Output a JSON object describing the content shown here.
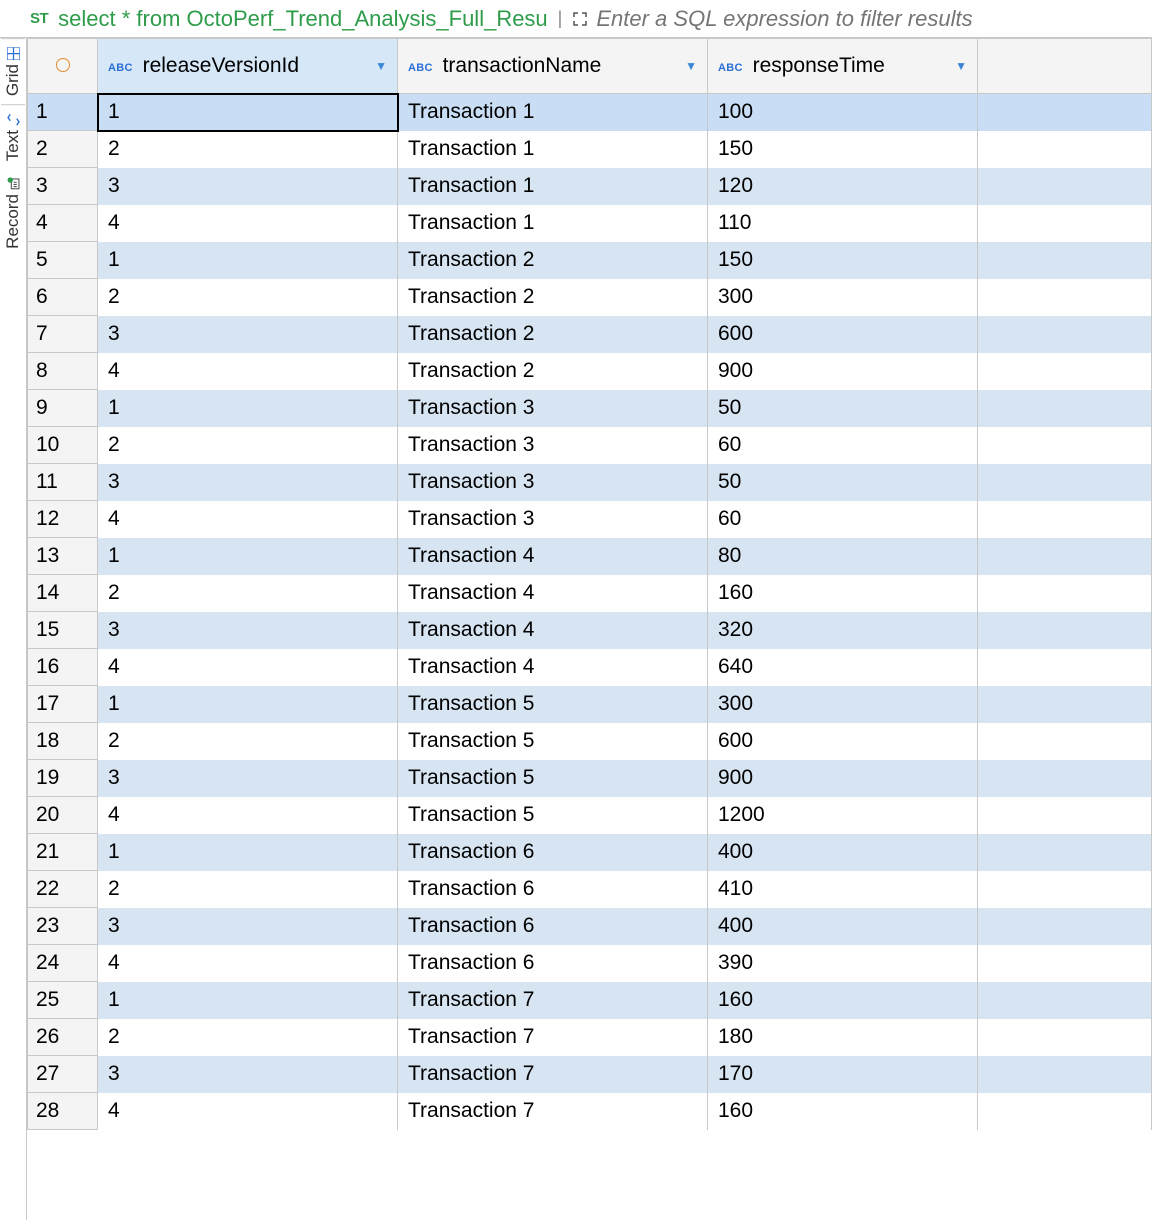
{
  "toolbar": {
    "sql_badge": "ST",
    "query": "select * from OctoPerf_Trend_Analysis_Full_Resu",
    "filter_placeholder": "Enter a SQL expression to filter results"
  },
  "sidebar": {
    "tabs": [
      {
        "label": "Grid",
        "icon": "grid-icon"
      },
      {
        "label": "Text",
        "icon": "text-arrows-icon"
      },
      {
        "label": "Record",
        "icon": "record-icon"
      }
    ]
  },
  "grid": {
    "columns": [
      {
        "type_badge": "ABC",
        "name": "releaseVersionId"
      },
      {
        "type_badge": "ABC",
        "name": "transactionName"
      },
      {
        "type_badge": "ABC",
        "name": "responseTime"
      }
    ],
    "selected_row": 1,
    "selected_col": 0,
    "rows": [
      {
        "n": 1,
        "c": [
          "1",
          "Transaction 1",
          "100"
        ]
      },
      {
        "n": 2,
        "c": [
          "2",
          "Transaction 1",
          "150"
        ]
      },
      {
        "n": 3,
        "c": [
          "3",
          "Transaction 1",
          "120"
        ]
      },
      {
        "n": 4,
        "c": [
          "4",
          "Transaction 1",
          "110"
        ]
      },
      {
        "n": 5,
        "c": [
          "1",
          "Transaction 2",
          "150"
        ]
      },
      {
        "n": 6,
        "c": [
          "2",
          "Transaction 2",
          "300"
        ]
      },
      {
        "n": 7,
        "c": [
          "3",
          "Transaction 2",
          "600"
        ]
      },
      {
        "n": 8,
        "c": [
          "4",
          "Transaction 2",
          "900"
        ]
      },
      {
        "n": 9,
        "c": [
          "1",
          "Transaction 3",
          "50"
        ]
      },
      {
        "n": 10,
        "c": [
          "2",
          "Transaction 3",
          "60"
        ]
      },
      {
        "n": 11,
        "c": [
          "3",
          "Transaction 3",
          "50"
        ]
      },
      {
        "n": 12,
        "c": [
          "4",
          "Transaction 3",
          "60"
        ]
      },
      {
        "n": 13,
        "c": [
          "1",
          "Transaction 4",
          "80"
        ]
      },
      {
        "n": 14,
        "c": [
          "2",
          "Transaction 4",
          "160"
        ]
      },
      {
        "n": 15,
        "c": [
          "3",
          "Transaction 4",
          "320"
        ]
      },
      {
        "n": 16,
        "c": [
          "4",
          "Transaction 4",
          "640"
        ]
      },
      {
        "n": 17,
        "c": [
          "1",
          "Transaction 5",
          "300"
        ]
      },
      {
        "n": 18,
        "c": [
          "2",
          "Transaction 5",
          "600"
        ]
      },
      {
        "n": 19,
        "c": [
          "3",
          "Transaction 5",
          "900"
        ]
      },
      {
        "n": 20,
        "c": [
          "4",
          "Transaction 5",
          "1200"
        ]
      },
      {
        "n": 21,
        "c": [
          "1",
          "Transaction 6",
          "400"
        ]
      },
      {
        "n": 22,
        "c": [
          "2",
          "Transaction 6",
          "410"
        ]
      },
      {
        "n": 23,
        "c": [
          "3",
          "Transaction 6",
          "400"
        ]
      },
      {
        "n": 24,
        "c": [
          "4",
          "Transaction 6",
          "390"
        ]
      },
      {
        "n": 25,
        "c": [
          "1",
          "Transaction 7",
          "160"
        ]
      },
      {
        "n": 26,
        "c": [
          "2",
          "Transaction 7",
          "180"
        ]
      },
      {
        "n": 27,
        "c": [
          "3",
          "Transaction 7",
          "170"
        ]
      },
      {
        "n": 28,
        "c": [
          "4",
          "Transaction 7",
          "160"
        ]
      }
    ]
  }
}
